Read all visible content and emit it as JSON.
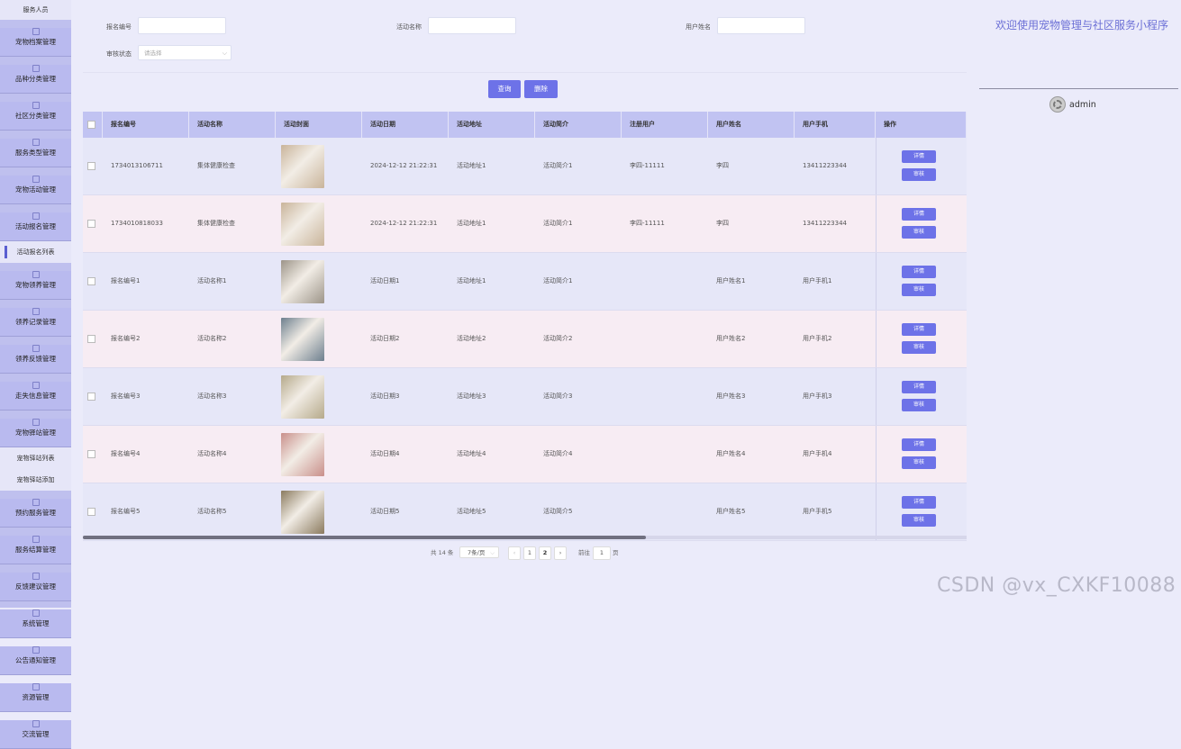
{
  "sidebar": {
    "top_label": "服务人员",
    "items": [
      {
        "label": "宠物档案管理",
        "type": "item"
      },
      {
        "label": "品种分类管理",
        "type": "item"
      },
      {
        "label": "社区分类管理",
        "type": "item"
      },
      {
        "label": "服务类型管理",
        "type": "item"
      },
      {
        "label": "宠物活动管理",
        "type": "item"
      },
      {
        "label": "活动报名管理",
        "type": "item"
      },
      {
        "label": "活动报名列表",
        "type": "sub",
        "active": true
      },
      {
        "label": "宠物领养管理",
        "type": "item"
      },
      {
        "label": "领养记录管理",
        "type": "item"
      },
      {
        "label": "领养反馈管理",
        "type": "item"
      },
      {
        "label": "走失信息管理",
        "type": "item"
      },
      {
        "label": "宠物驿站管理",
        "type": "item"
      },
      {
        "label": "宠物驿站列表",
        "type": "sub"
      },
      {
        "label": "宠物驿站添加",
        "type": "sub"
      },
      {
        "label": "预约服务管理",
        "type": "item"
      },
      {
        "label": "服务结算管理",
        "type": "item"
      },
      {
        "label": "反馈建议管理",
        "type": "item"
      },
      {
        "label": "系统管理",
        "type": "item"
      },
      {
        "label": "公告通知管理",
        "type": "item"
      },
      {
        "label": "资源管理",
        "type": "item"
      },
      {
        "label": "交流管理",
        "type": "item"
      }
    ]
  },
  "search": {
    "field1_label": "报名编号",
    "field2_label": "活动名称",
    "field3_label": "用户姓名",
    "status_label": "审核状态",
    "status_placeholder": "请选择",
    "query_button": "查询",
    "delete_button": "删除"
  },
  "table": {
    "headers": [
      "报名编号",
      "活动名称",
      "活动封面",
      "活动日期",
      "活动地址",
      "活动简介",
      "注册用户",
      "用户姓名",
      "用户手机",
      "操作"
    ],
    "rows": [
      {
        "id": "1734013106711",
        "name": "集体健康检查",
        "date": "2024-12-12 21:22:31",
        "addr": "活动地址1",
        "intro": "活动简介1",
        "user": "李四-11111",
        "uname": "李四",
        "phone": "13411223344",
        "thumb": "#c9b49a"
      },
      {
        "id": "1734010818033",
        "name": "集体健康检查",
        "date": "2024-12-12 21:22:31",
        "addr": "活动地址1",
        "intro": "活动简介1",
        "user": "李四-11111",
        "uname": "李四",
        "phone": "13411223344",
        "thumb": "#c9b49a"
      },
      {
        "id": "报名编号1",
        "name": "活动名称1",
        "date": "活动日期1",
        "addr": "活动地址1",
        "intro": "活动简介1",
        "user": "",
        "uname": "用户姓名1",
        "phone": "用户手机1",
        "thumb": "#9c9488"
      },
      {
        "id": "报名编号2",
        "name": "活动名称2",
        "date": "活动日期2",
        "addr": "活动地址2",
        "intro": "活动简介2",
        "user": "",
        "uname": "用户姓名2",
        "phone": "用户手机2",
        "thumb": "#6d7f8e"
      },
      {
        "id": "报名编号3",
        "name": "活动名称3",
        "date": "活动日期3",
        "addr": "活动地址3",
        "intro": "活动简介3",
        "user": "",
        "uname": "用户姓名3",
        "phone": "用户手机3",
        "thumb": "#b5a98a"
      },
      {
        "id": "报名编号4",
        "name": "活动名称4",
        "date": "活动日期4",
        "addr": "活动地址4",
        "intro": "活动简介4",
        "user": "",
        "uname": "用户姓名4",
        "phone": "用户手机4",
        "thumb": "#c98f8a"
      },
      {
        "id": "报名编号5",
        "name": "活动名称5",
        "date": "活动日期5",
        "addr": "活动地址5",
        "intro": "活动简介5",
        "user": "",
        "uname": "用户姓名5",
        "phone": "用户手机5",
        "thumb": "#8a7a5e"
      }
    ],
    "detail_button": "详情",
    "review_button": "审核"
  },
  "pagination": {
    "total_text": "共 14 条",
    "page_size": "7条/页",
    "prev": "‹",
    "page1": "1",
    "page2": "2",
    "next": "›",
    "goto_label": "前往",
    "goto_value": "1",
    "page_suffix": "页"
  },
  "header": {
    "welcome": "欢迎使用宠物管理与社区服务小程序",
    "user": "admin"
  },
  "watermark": "CSDN @vx_CXKF10088",
  "colors": {
    "accent": "#6d72e8",
    "sidebar": "#bfc0ee",
    "header_row": "#c1c3f2"
  }
}
